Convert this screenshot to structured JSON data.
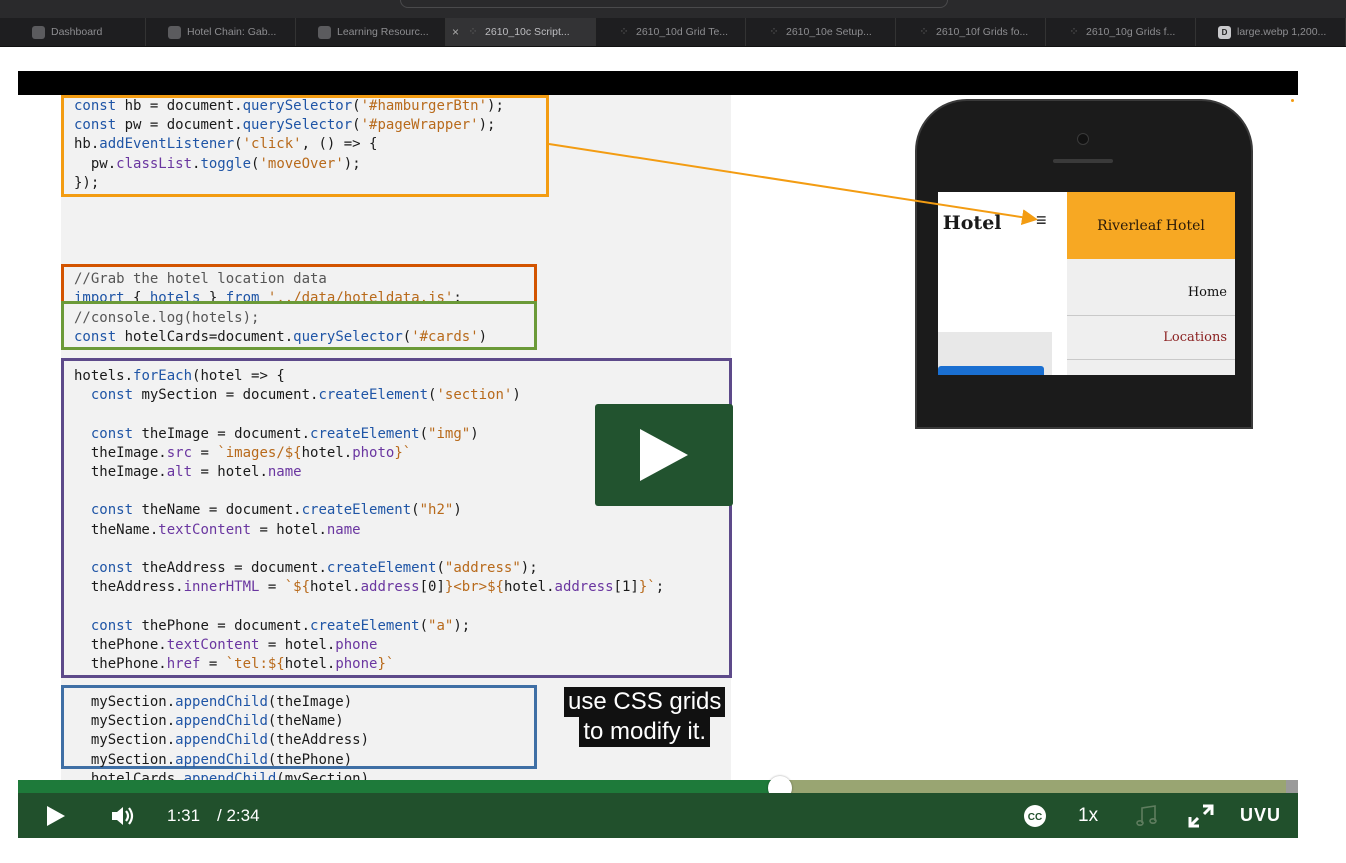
{
  "browser": {
    "tabs": [
      {
        "label": "Dashboard",
        "icon": "canvas-icon",
        "width": 146
      },
      {
        "label": "Hotel Chain: Gab...",
        "icon": "canvas-icon",
        "width": 150
      },
      {
        "label": "Learning Resourc...",
        "icon": "canvas-icon",
        "width": 150
      },
      {
        "label": "2610_10c Script...",
        "icon": "loading-spinner-icon",
        "width": 150,
        "active": true
      },
      {
        "label": "2610_10d Grid Te...",
        "icon": "loading-spinner-icon",
        "width": 150
      },
      {
        "label": "2610_10e Setup...",
        "icon": "loading-spinner-icon",
        "width": 150
      },
      {
        "label": "2610_10f Grids fo...",
        "icon": "loading-spinner-icon",
        "width": 150
      },
      {
        "label": "2610_10g Grids f...",
        "icon": "loading-spinner-icon",
        "width": 150
      },
      {
        "label": "large.webp 1,200...",
        "icon": "d-badge-icon",
        "width": 150
      }
    ],
    "close_glyph": "×"
  },
  "slide": {
    "phone": {
      "hotel_title": "f Hotel",
      "menu_header": "Riverleaf Hotel",
      "menu_items": [
        "Home",
        "Locations"
      ],
      "burger_glyph": "≡"
    },
    "colors": {
      "orange": "#f39c12",
      "red": "#d35400",
      "green": "#6b9a38",
      "purple": "#5d4a8a",
      "blue": "#3f6fa5"
    }
  },
  "video": {
    "caption_lines": [
      "use CSS grids",
      "to modify it."
    ],
    "current_time": "1:31",
    "duration": "/ 2:34",
    "progress": 0.595,
    "speed": "1x",
    "cc_label": "CC",
    "brand": "UVU"
  }
}
